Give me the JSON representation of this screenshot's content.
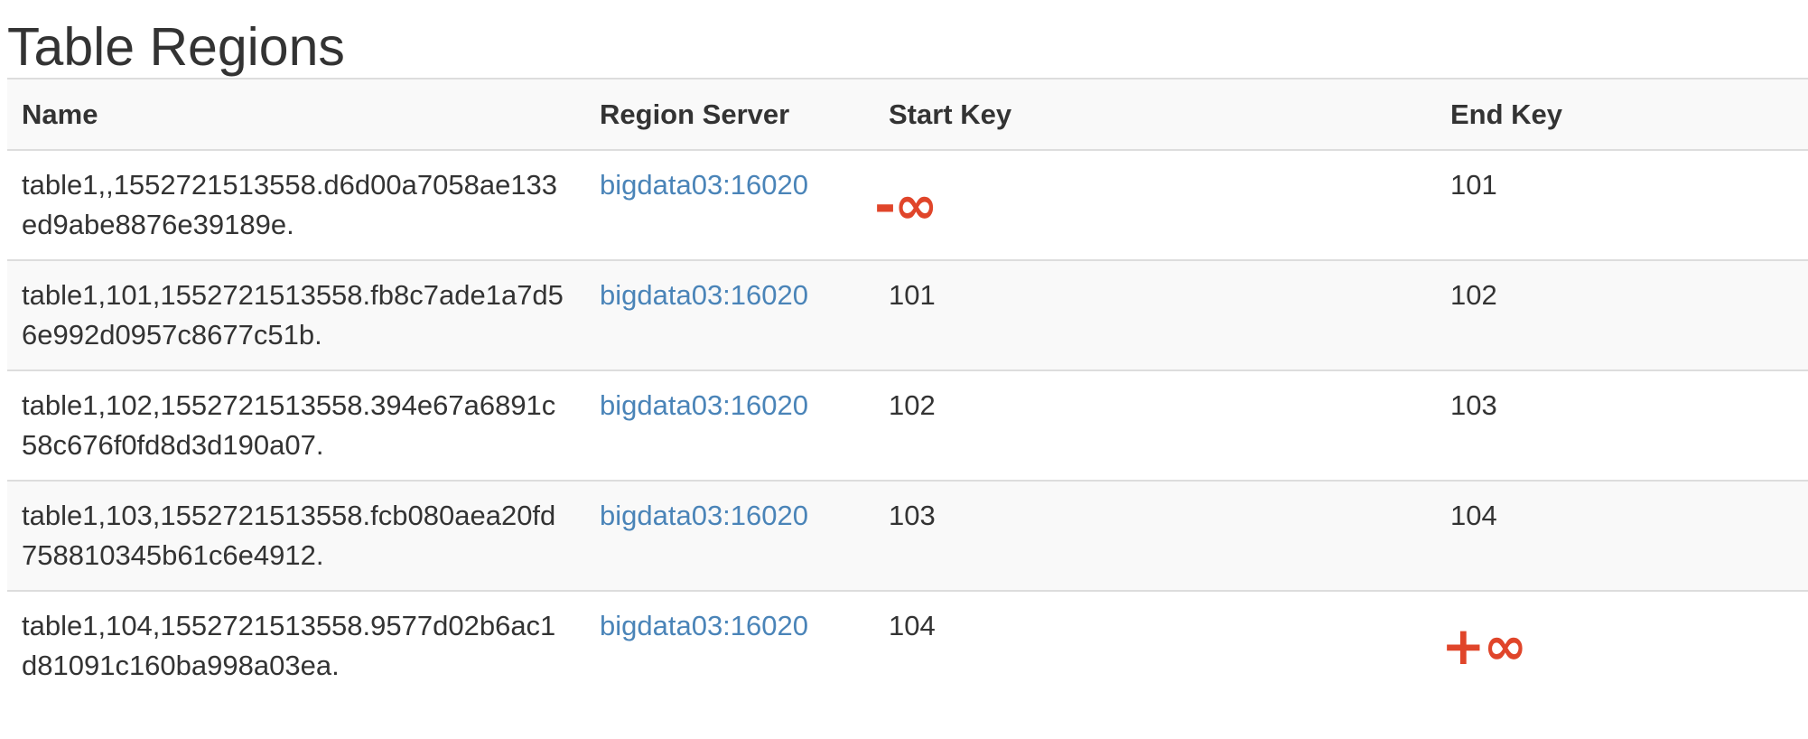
{
  "page": {
    "title": "Table Regions"
  },
  "table": {
    "headers": {
      "name": "Name",
      "region_server": "Region Server",
      "start_key": "Start Key",
      "end_key": "End Key"
    },
    "rows": [
      {
        "name": "table1,,1552721513558.d6d00a7058ae133ed9abe8876e39189e.",
        "region_server": "bigdata03:16020",
        "start_key": "-∞",
        "end_key": "101"
      },
      {
        "name": "table1,101,1552721513558.fb8c7ade1a7d56e992d0957c8677c51b.",
        "region_server": "bigdata03:16020",
        "start_key": "101",
        "end_key": "102"
      },
      {
        "name": "table1,102,1552721513558.394e67a6891c58c676f0fd8d3d190a07.",
        "region_server": "bigdata03:16020",
        "start_key": "102",
        "end_key": "103"
      },
      {
        "name": "table1,103,1552721513558.fcb080aea20fd758810345b61c6e4912.",
        "region_server": "bigdata03:16020",
        "start_key": "103",
        "end_key": "104"
      },
      {
        "name": "table1,104,1552721513558.9577d02b6ac1d81091c160ba998a03ea.",
        "region_server": "bigdata03:16020",
        "start_key": "104",
        "end_key": "+∞"
      }
    ]
  },
  "colors": {
    "link": "#4a84b8",
    "infinity": "#e0452a",
    "striped_row": "#f9f9f9",
    "border": "#dddddd"
  }
}
